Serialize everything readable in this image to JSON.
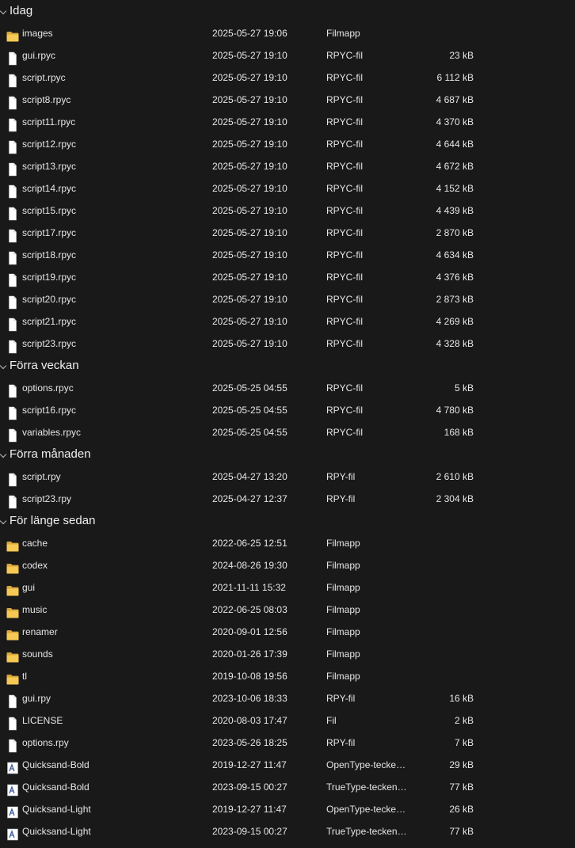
{
  "colors": {
    "background": "#191919",
    "text": "#e6e6e6",
    "folder": "#f2c14e",
    "file": "#ffffff"
  },
  "groups": [
    {
      "title": "Idag",
      "items": [
        {
          "icon": "folder",
          "name": "images",
          "date": "2025-05-27 19:06",
          "type": "Filmapp",
          "size": ""
        },
        {
          "icon": "file",
          "name": "gui.rpyc",
          "date": "2025-05-27 19:10",
          "type": "RPYC-fil",
          "size": "23 kB"
        },
        {
          "icon": "file",
          "name": "script.rpyc",
          "date": "2025-05-27 19:10",
          "type": "RPYC-fil",
          "size": "6 112 kB"
        },
        {
          "icon": "file",
          "name": "script8.rpyc",
          "date": "2025-05-27 19:10",
          "type": "RPYC-fil",
          "size": "4 687 kB"
        },
        {
          "icon": "file",
          "name": "script11.rpyc",
          "date": "2025-05-27 19:10",
          "type": "RPYC-fil",
          "size": "4 370 kB"
        },
        {
          "icon": "file",
          "name": "script12.rpyc",
          "date": "2025-05-27 19:10",
          "type": "RPYC-fil",
          "size": "4 644 kB"
        },
        {
          "icon": "file",
          "name": "script13.rpyc",
          "date": "2025-05-27 19:10",
          "type": "RPYC-fil",
          "size": "4 672 kB"
        },
        {
          "icon": "file",
          "name": "script14.rpyc",
          "date": "2025-05-27 19:10",
          "type": "RPYC-fil",
          "size": "4 152 kB"
        },
        {
          "icon": "file",
          "name": "script15.rpyc",
          "date": "2025-05-27 19:10",
          "type": "RPYC-fil",
          "size": "4 439 kB"
        },
        {
          "icon": "file",
          "name": "script17.rpyc",
          "date": "2025-05-27 19:10",
          "type": "RPYC-fil",
          "size": "2 870 kB"
        },
        {
          "icon": "file",
          "name": "script18.rpyc",
          "date": "2025-05-27 19:10",
          "type": "RPYC-fil",
          "size": "4 634 kB"
        },
        {
          "icon": "file",
          "name": "script19.rpyc",
          "date": "2025-05-27 19:10",
          "type": "RPYC-fil",
          "size": "4 376 kB"
        },
        {
          "icon": "file",
          "name": "script20.rpyc",
          "date": "2025-05-27 19:10",
          "type": "RPYC-fil",
          "size": "2 873 kB"
        },
        {
          "icon": "file",
          "name": "script21.rpyc",
          "date": "2025-05-27 19:10",
          "type": "RPYC-fil",
          "size": "4 269 kB"
        },
        {
          "icon": "file",
          "name": "script23.rpyc",
          "date": "2025-05-27 19:10",
          "type": "RPYC-fil",
          "size": "4 328 kB"
        }
      ]
    },
    {
      "title": "Förra veckan",
      "items": [
        {
          "icon": "file",
          "name": "options.rpyc",
          "date": "2025-05-25 04:55",
          "type": "RPYC-fil",
          "size": "5 kB"
        },
        {
          "icon": "file",
          "name": "script16.rpyc",
          "date": "2025-05-25 04:55",
          "type": "RPYC-fil",
          "size": "4 780 kB"
        },
        {
          "icon": "file",
          "name": "variables.rpyc",
          "date": "2025-05-25 04:55",
          "type": "RPYC-fil",
          "size": "168 kB"
        }
      ]
    },
    {
      "title": "Förra månaden",
      "items": [
        {
          "icon": "file",
          "name": "script.rpy",
          "date": "2025-04-27 13:20",
          "type": "RPY-fil",
          "size": "2 610 kB"
        },
        {
          "icon": "file",
          "name": "script23.rpy",
          "date": "2025-04-27 12:37",
          "type": "RPY-fil",
          "size": "2 304 kB"
        }
      ]
    },
    {
      "title": "För länge sedan",
      "items": [
        {
          "icon": "folder",
          "name": "cache",
          "date": "2022-06-25 12:51",
          "type": "Filmapp",
          "size": ""
        },
        {
          "icon": "folder",
          "name": "codex",
          "date": "2024-08-26 19:30",
          "type": "Filmapp",
          "size": ""
        },
        {
          "icon": "folder",
          "name": "gui",
          "date": "2021-11-11 15:32",
          "type": "Filmapp",
          "size": ""
        },
        {
          "icon": "folder",
          "name": "music",
          "date": "2022-06-25 08:03",
          "type": "Filmapp",
          "size": ""
        },
        {
          "icon": "folder",
          "name": "renamer",
          "date": "2020-09-01 12:56",
          "type": "Filmapp",
          "size": ""
        },
        {
          "icon": "folder",
          "name": "sounds",
          "date": "2020-01-26 17:39",
          "type": "Filmapp",
          "size": ""
        },
        {
          "icon": "folder",
          "name": "tl",
          "date": "2019-10-08 19:56",
          "type": "Filmapp",
          "size": ""
        },
        {
          "icon": "file",
          "name": "gui.rpy",
          "date": "2023-10-06 18:33",
          "type": "RPY-fil",
          "size": "16 kB"
        },
        {
          "icon": "file",
          "name": "LICENSE",
          "date": "2020-08-03 17:47",
          "type": "Fil",
          "size": "2 kB"
        },
        {
          "icon": "file",
          "name": "options.rpy",
          "date": "2023-05-26 18:25",
          "type": "RPY-fil",
          "size": "7 kB"
        },
        {
          "icon": "font",
          "name": "Quicksand-Bold",
          "date": "2019-12-27 11:47",
          "type": "OpenType-teckens...",
          "size": "29 kB"
        },
        {
          "icon": "font",
          "name": "Quicksand-Bold",
          "date": "2023-09-15 00:27",
          "type": "TrueType-teckens...",
          "size": "77 kB"
        },
        {
          "icon": "font",
          "name": "Quicksand-Light",
          "date": "2019-12-27 11:47",
          "type": "OpenType-teckens...",
          "size": "26 kB"
        },
        {
          "icon": "font",
          "name": "Quicksand-Light",
          "date": "2023-09-15 00:27",
          "type": "TrueType-teckens...",
          "size": "77 kB"
        }
      ]
    }
  ]
}
